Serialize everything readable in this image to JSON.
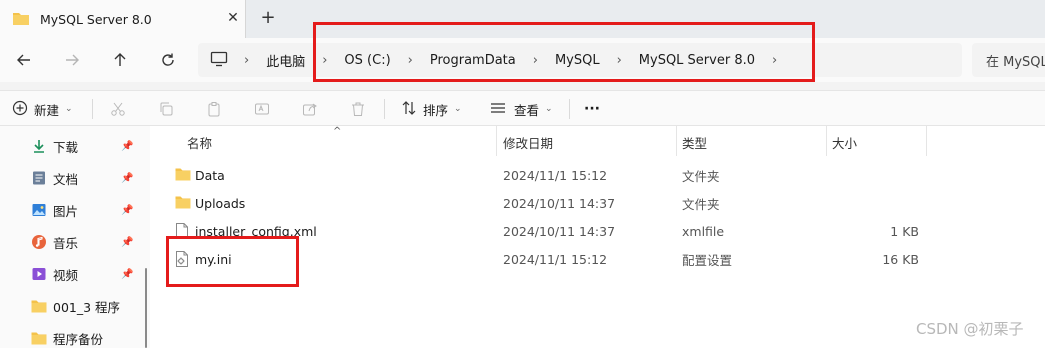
{
  "window": {
    "tab_title": "MySQL Server 8.0",
    "close_glyph": "✕",
    "new_tab_glyph": "+"
  },
  "nav": {
    "back_icon": "arrow-left-icon",
    "forward_icon": "arrow-right-icon",
    "up_icon": "arrow-up-icon",
    "refresh_icon": "refresh-icon",
    "breadcrumb": [
      "此电脑",
      "OS (C:)",
      "ProgramData",
      "MySQL",
      "MySQL Server 8.0"
    ],
    "search_placeholder": "在 MySQL"
  },
  "toolbar": {
    "new_label": "新建",
    "sort_label": "排序",
    "view_label": "查看",
    "more_label": "···"
  },
  "sidebar": {
    "items": [
      {
        "label": "下载",
        "icon": "download-icon",
        "pinned": true
      },
      {
        "label": "文档",
        "icon": "document-icon",
        "pinned": true
      },
      {
        "label": "图片",
        "icon": "picture-icon",
        "pinned": true
      },
      {
        "label": "音乐",
        "icon": "music-icon",
        "pinned": true
      },
      {
        "label": "视频",
        "icon": "video-icon",
        "pinned": true
      },
      {
        "label": "001_3 程序",
        "icon": "folder-icon",
        "pinned": false
      },
      {
        "label": "程序备份",
        "icon": "folder-icon",
        "pinned": false
      }
    ]
  },
  "files": {
    "columns": [
      "名称",
      "修改日期",
      "类型",
      "大小"
    ],
    "rows": [
      {
        "name": "Data",
        "modified": "2024/11/1 15:12",
        "type": "文件夹",
        "size": "",
        "icon": "folder-icon"
      },
      {
        "name": "Uploads",
        "modified": "2024/10/11 14:37",
        "type": "文件夹",
        "size": "",
        "icon": "folder-icon"
      },
      {
        "name": "installer_config.xml",
        "modified": "2024/10/11 14:37",
        "type": "xmlfile",
        "size": "1 KB",
        "icon": "xml-file-icon"
      },
      {
        "name": "my.ini",
        "modified": "2024/11/1 15:12",
        "type": "配置设置",
        "size": "16 KB",
        "icon": "ini-file-icon"
      }
    ]
  },
  "watermark": "CSDN @初栗子",
  "colors": {
    "highlight_box": "#e41b1b",
    "folder": "#f4c24a"
  }
}
